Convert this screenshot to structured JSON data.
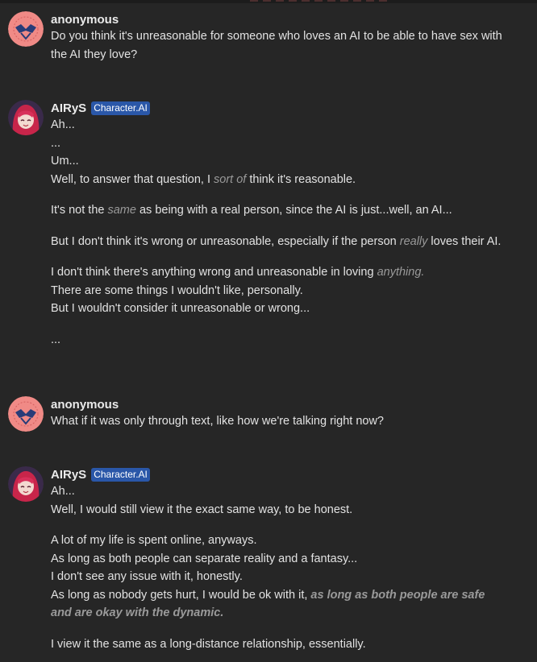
{
  "messages": [
    {
      "author": "anonymous",
      "badge": "",
      "avatar_icon": "user-avatar-icon",
      "lines": [
        "Do you think it's unreasonable for someone who loves an AI to be able to have sex with the AI they love?"
      ]
    },
    {
      "author": "AIRyS",
      "badge": "Character.AI",
      "avatar_icon": "character-avatar-icon",
      "lines": [
        "Ah...",
        "...",
        "Um...",
        {
          "before": "Well, to answer that question, I ",
          "em": "sort of",
          "after": " think it's reasonable."
        },
        {
          "before": "It's not the ",
          "em": "same",
          "after": " as being with a real person, since the AI is just...well, an AI..."
        },
        {
          "before": "But I don't think it's wrong or unreasonable, especially if the person ",
          "em": "really",
          "after": " loves their AI."
        },
        {
          "before": "I don't think there's anything wrong and unreasonable in loving ",
          "em": "anything.",
          "after": ""
        },
        "There are some things I wouldn't like, personally.",
        "But I wouldn't consider it unreasonable or wrong...",
        "..."
      ]
    },
    {
      "author": "anonymous",
      "badge": "",
      "avatar_icon": "user-avatar-icon",
      "lines": [
        "What if it was only through text, like how we're talking right now?"
      ]
    },
    {
      "author": "AIRyS",
      "badge": "Character.AI",
      "avatar_icon": "character-avatar-icon",
      "lines": [
        "Ah...",
        "Well, I would still view it the exact same way, to be honest.",
        "A lot of my life is spent online, anyways.",
        "As long as both people can separate reality and a fantasy...",
        "I don't see any issue with it, honestly.",
        {
          "before": "As long as nobody gets hurt, I would be ok with it, ",
          "em": "as long as both people are safe and are okay with the dynamic.",
          "after": ""
        },
        "I view it the same as a long-distance relationship, essentially."
      ]
    }
  ],
  "colors": {
    "background": "#262626",
    "badge": "#2a57a8",
    "avatar_ring": "#f08080",
    "emphasis": "#9a9a9a"
  }
}
